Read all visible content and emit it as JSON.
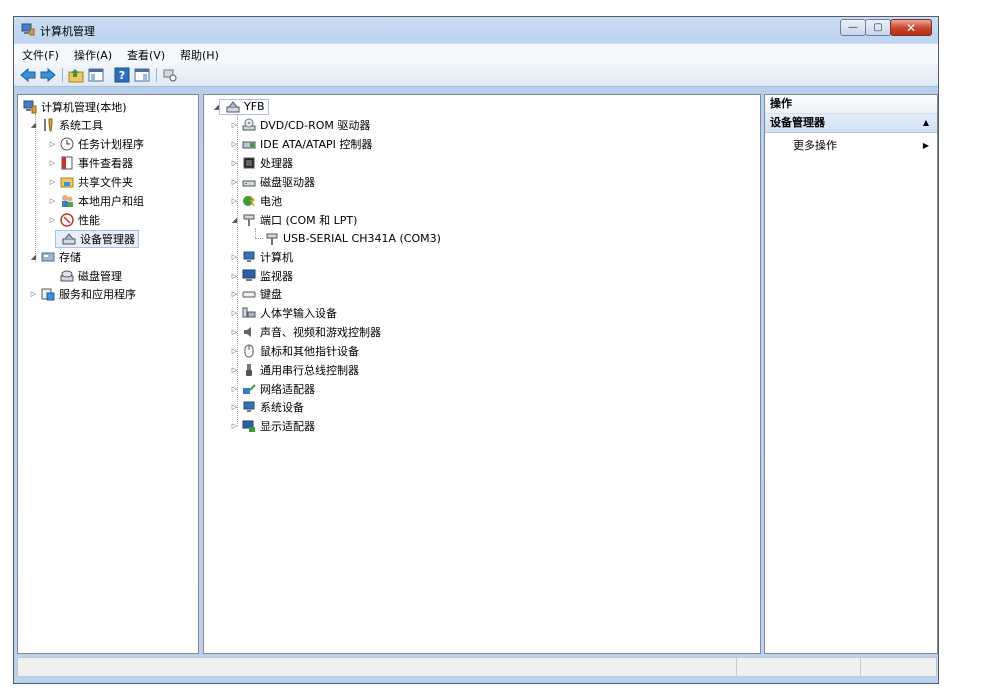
{
  "window": {
    "title": "计算机管理",
    "buttons": {
      "minimize": "—",
      "maximize": "▢",
      "close": "✕"
    }
  },
  "menubar": {
    "items": [
      "文件(F)",
      "操作(A)",
      "查看(V)",
      "帮助(H)"
    ]
  },
  "toolbar": {
    "icons": [
      "back-icon",
      "forward-icon",
      "up-icon",
      "show-hide-tree-icon",
      "help-icon",
      "show-hide-action-icon",
      "properties-icon"
    ]
  },
  "left_tree": {
    "root": "计算机管理(本地)",
    "items": [
      {
        "label": "系统工具",
        "level": 1,
        "expanded": true,
        "icon": "tools-icon"
      },
      {
        "label": "任务计划程序",
        "level": 2,
        "expanded": false,
        "icon": "clock-icon"
      },
      {
        "label": "事件查看器",
        "level": 2,
        "expanded": false,
        "icon": "event-viewer-icon"
      },
      {
        "label": "共享文件夹",
        "level": 2,
        "expanded": false,
        "icon": "shared-folder-icon"
      },
      {
        "label": "本地用户和组",
        "level": 2,
        "expanded": false,
        "icon": "users-icon"
      },
      {
        "label": "性能",
        "level": 2,
        "expanded": false,
        "icon": "performance-icon"
      },
      {
        "label": "设备管理器",
        "level": 2,
        "selected": true,
        "icon": "device-manager-icon"
      },
      {
        "label": "存储",
        "level": 1,
        "expanded": true,
        "icon": "storage-icon"
      },
      {
        "label": "磁盘管理",
        "level": 2,
        "icon": "disk-management-icon"
      },
      {
        "label": "服务和应用程序",
        "level": 1,
        "expanded": false,
        "icon": "services-icon"
      }
    ]
  },
  "device_tree": {
    "root": "YFB",
    "items": [
      {
        "label": "DVD/CD-ROM 驱动器",
        "icon": "dvd-drive-icon"
      },
      {
        "label": "IDE ATA/ATAPI 控制器",
        "icon": "ide-controller-icon"
      },
      {
        "label": "处理器",
        "icon": "processor-icon"
      },
      {
        "label": "磁盘驱动器",
        "icon": "disk-drive-icon"
      },
      {
        "label": "电池",
        "icon": "battery-icon"
      },
      {
        "label": "端口 (COM 和 LPT)",
        "icon": "port-icon",
        "expanded": true
      },
      {
        "label": "USB-SERIAL CH341A (COM3)",
        "icon": "port-icon",
        "child": true
      },
      {
        "label": "计算机",
        "icon": "computer-icon"
      },
      {
        "label": "监视器",
        "icon": "monitor-icon"
      },
      {
        "label": "键盘",
        "icon": "keyboard-icon"
      },
      {
        "label": "人体学输入设备",
        "icon": "hid-icon"
      },
      {
        "label": "声音、视频和游戏控制器",
        "icon": "sound-icon"
      },
      {
        "label": "鼠标和其他指针设备",
        "icon": "mouse-icon"
      },
      {
        "label": "通用串行总线控制器",
        "icon": "usb-icon"
      },
      {
        "label": "网络适配器",
        "icon": "network-adapter-icon"
      },
      {
        "label": "系统设备",
        "icon": "system-device-icon"
      },
      {
        "label": "显示适配器",
        "icon": "display-adapter-icon"
      }
    ]
  },
  "actions": {
    "header": "操作",
    "section": "设备管理器",
    "section_arrow": "▲",
    "more": "更多操作",
    "more_arrow": "▶"
  },
  "colors": {
    "accent": "#b9d1ee",
    "selection": "#e7eef7"
  }
}
